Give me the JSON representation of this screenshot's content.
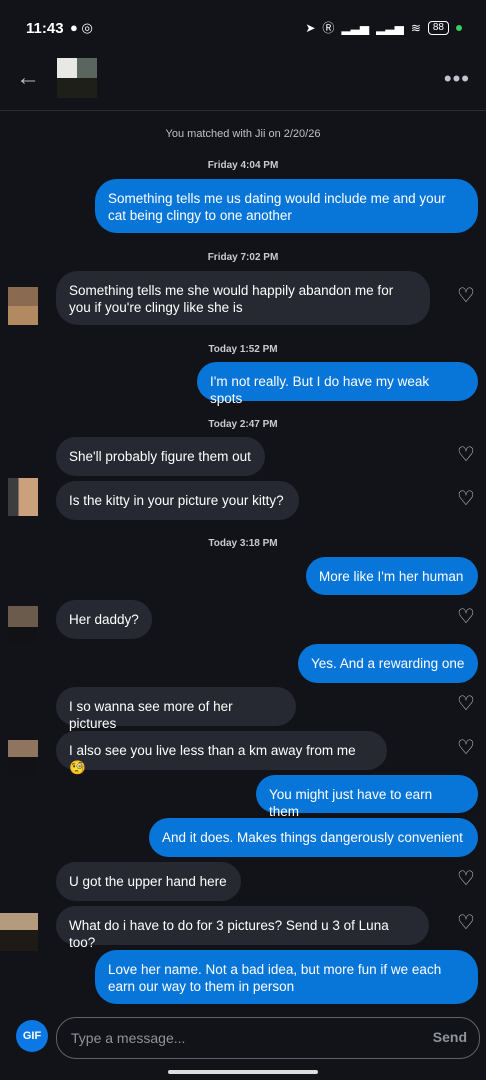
{
  "status": {
    "time": "11:43",
    "battery": "88"
  },
  "header": {
    "back_icon": "←",
    "more_icon": "•••"
  },
  "matched_text": "You matched with Jii on 2/20/26",
  "stamps": [
    "Friday 4:04 PM",
    "Friday 7:02 PM",
    "Today 1:52 PM",
    "Today 2:47 PM",
    "Today 3:18 PM"
  ],
  "messages": [
    "Something tells me us dating would include me and your cat being clingy to one another",
    "Something tells me she would happily abandon me for you if you're clingy like she is",
    "I'm not really. But I do have my weak spots",
    "She'll probably figure them out",
    "Is the kitty in your picture your kitty?",
    "More like I'm her human",
    "Her daddy?",
    "Yes. And a rewarding one",
    "I so wanna see more of her pictures",
    "I also see you live less than a km away from me 🧐",
    "You might just have to earn them",
    "And it does. Makes things dangerously convenient",
    "U got the upper hand here",
    "What do i have to do for 3 pictures? Send u 3 of Luna too?",
    "Love her name. Not a bad idea, but more fun if we each earn our way to them in person"
  ],
  "composer": {
    "gif": "GIF",
    "placeholder": "Type a message...",
    "send": "Send"
  },
  "icons": {
    "heart": "♡"
  }
}
